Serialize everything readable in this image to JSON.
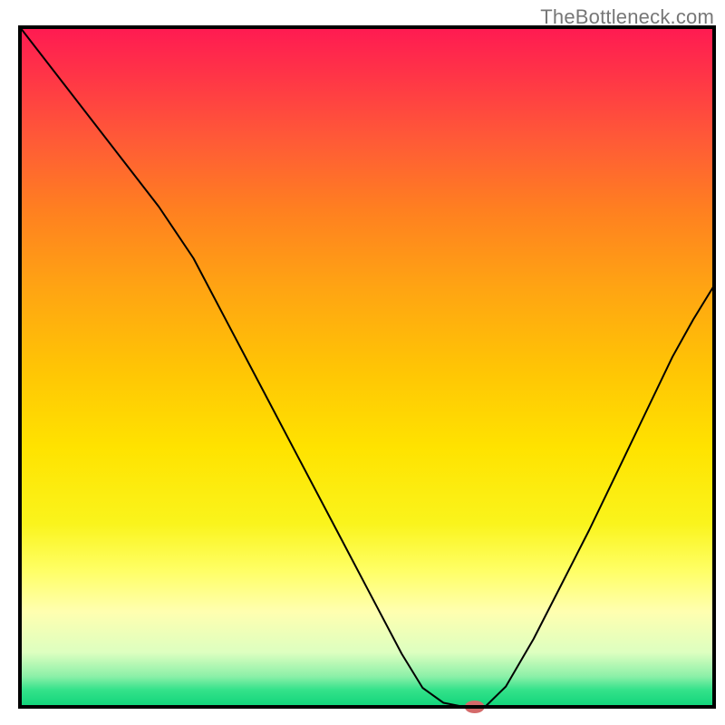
{
  "attribution": "TheBottleneck.com",
  "chart_data": {
    "type": "line",
    "title": "",
    "xlabel": "",
    "ylabel": "",
    "xlim": [
      0,
      100
    ],
    "ylim": [
      0,
      100
    ],
    "grid": false,
    "legend": false,
    "background_gradient": {
      "stops": [
        {
          "offset": 0.0,
          "color": "#ff1a52"
        },
        {
          "offset": 0.07,
          "color": "#ff3447"
        },
        {
          "offset": 0.16,
          "color": "#ff5838"
        },
        {
          "offset": 0.27,
          "color": "#ff8020"
        },
        {
          "offset": 0.38,
          "color": "#ffa313"
        },
        {
          "offset": 0.5,
          "color": "#ffc405"
        },
        {
          "offset": 0.62,
          "color": "#ffe300"
        },
        {
          "offset": 0.73,
          "color": "#faf41c"
        },
        {
          "offset": 0.8,
          "color": "#ffff66"
        },
        {
          "offset": 0.86,
          "color": "#ffffb0"
        },
        {
          "offset": 0.92,
          "color": "#ddffc0"
        },
        {
          "offset": 0.955,
          "color": "#8cf0a8"
        },
        {
          "offset": 0.975,
          "color": "#34e28a"
        },
        {
          "offset": 1.0,
          "color": "#0fd47a"
        }
      ]
    },
    "series": [
      {
        "name": "bottleneck-curve",
        "color": "#000000",
        "stroke_width": 2,
        "x": [
          0.0,
          5.0,
          10.0,
          15.0,
          20.0,
          25.0,
          30.0,
          35.0,
          40.0,
          45.0,
          50.0,
          55.0,
          58.0,
          61.0,
          64.0,
          67.0,
          70.0,
          74.0,
          78.0,
          82.0,
          86.0,
          90.0,
          94.0,
          97.0,
          100.0
        ],
        "y": [
          100.0,
          93.4,
          86.8,
          80.2,
          73.6,
          66.0,
          56.3,
          46.6,
          36.9,
          27.2,
          17.5,
          7.8,
          2.8,
          0.6,
          0.0,
          0.0,
          3.0,
          10.0,
          18.0,
          26.0,
          34.5,
          43.0,
          51.5,
          57.0,
          62.0
        ]
      }
    ],
    "marker": {
      "name": "optimal-point",
      "x": 65.5,
      "y": 0.0,
      "color": "#d46a6a",
      "rx": 11,
      "ry": 7
    }
  },
  "frame": {
    "stroke": "#000000",
    "stroke_width": 4
  }
}
